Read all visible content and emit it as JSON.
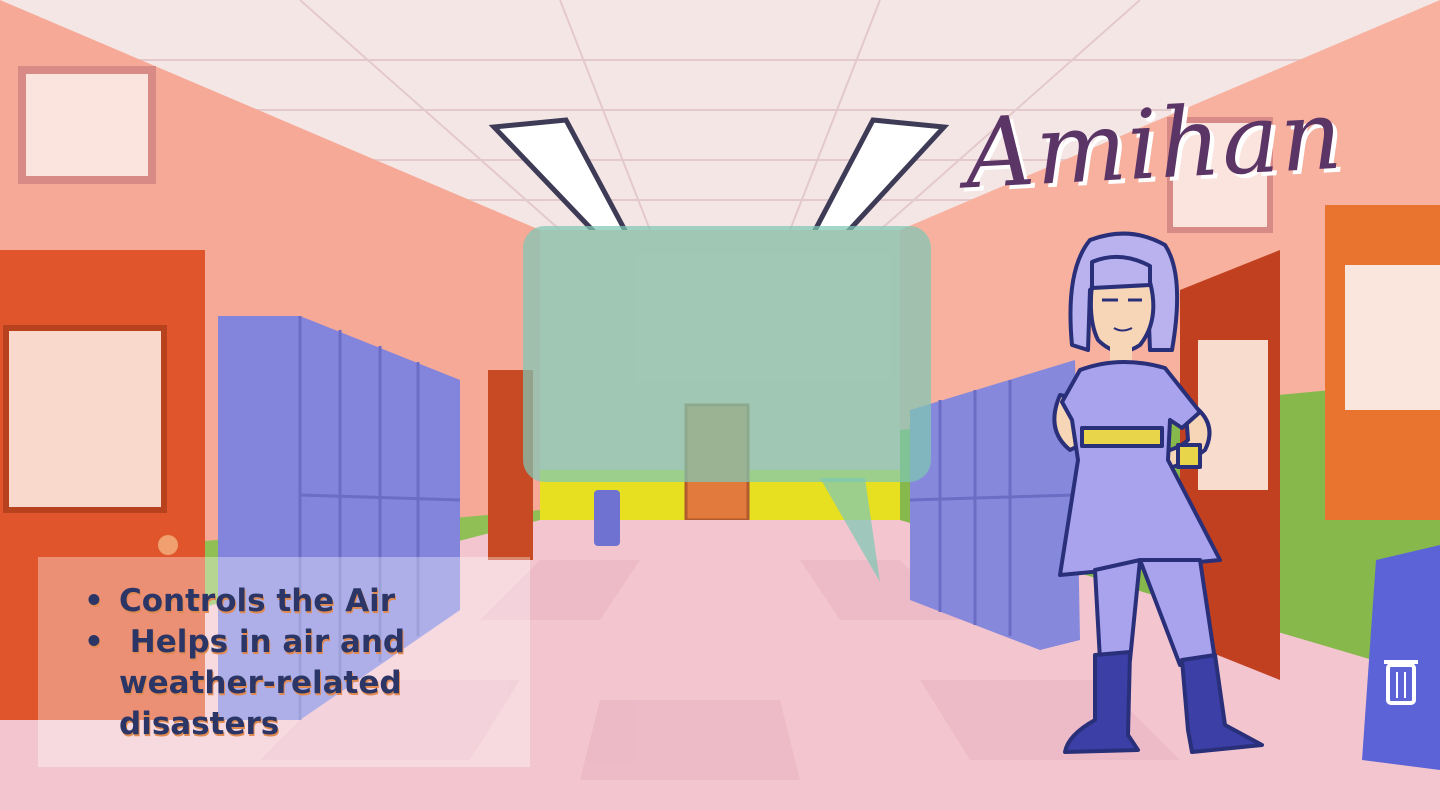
{
  "title": "Amihan",
  "bullets": [
    "Controls the Air",
    " Helps in air and weather-related disasters"
  ],
  "colors": {
    "title": "#5b3566",
    "bullet_text": "#2b3566",
    "bubble": "#7fc8b4",
    "wall": "#f6b9a6",
    "floor": "#f4c7cf",
    "locker": "#7d7fd9",
    "costume": "#a9a3ee"
  },
  "icons": [
    "trash-can-icon"
  ]
}
